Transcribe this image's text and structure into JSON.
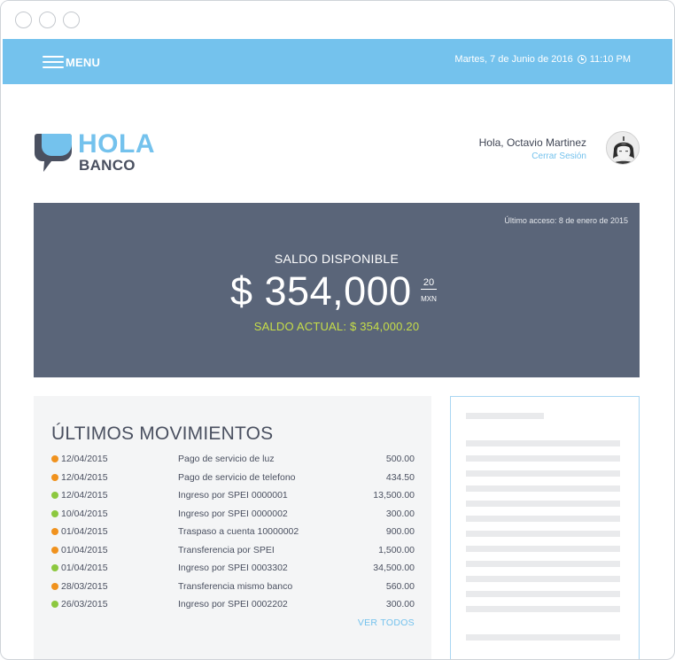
{
  "header": {
    "menu_label": "MENU",
    "date": "Martes, 7 de Junio de 2016",
    "time": "11:10 PM",
    "colors": {
      "topbar": "#74c2ed"
    }
  },
  "brand": {
    "name_top": "HOLA",
    "name_bottom": "BANCO",
    "logo_icon": "speech-bubble-icon"
  },
  "user": {
    "greeting": "Hola, Octavio Martinez",
    "logout_label": "Cerrar Sesión",
    "avatar": "avatar-photo"
  },
  "balance": {
    "last_access": "Último acceso: 8 de enero de 2015",
    "label": "SALDO DISPONIBLE",
    "amount": "$ 354,000",
    "cents": "20",
    "currency": "MXN",
    "current": "SALDO ACTUAL: $ 354,000.20",
    "colors": {
      "background": "#5a6579",
      "current": "#c7de48"
    }
  },
  "movements": {
    "title": "ÚLTIMOS MOVIMIENTOS",
    "see_all_label": "VER TODOS",
    "rows": [
      {
        "status": "orange",
        "date": "12/04/2015",
        "desc": "Pago de servicio de luz",
        "amount": "500.00"
      },
      {
        "status": "orange",
        "date": "12/04/2015",
        "desc": "Pago de servicio de telefono",
        "amount": "434.50"
      },
      {
        "status": "green",
        "date": "12/04/2015",
        "desc": "Ingreso por SPEI 0000001",
        "amount": "13,500.00"
      },
      {
        "status": "green",
        "date": "10/04/2015",
        "desc": "Ingreso por SPEI 0000002",
        "amount": "300.00"
      },
      {
        "status": "orange",
        "date": "01/04/2015",
        "desc": "Traspaso a cuenta 10000002",
        "amount": "900.00"
      },
      {
        "status": "orange",
        "date": "01/04/2015",
        "desc": "Transferencia por SPEI",
        "amount": "1,500.00"
      },
      {
        "status": "green",
        "date": "01/04/2015",
        "desc": "Ingreso por SPEI 0003302",
        "amount": "34,500.00"
      },
      {
        "status": "orange",
        "date": "28/03/2015",
        "desc": "Transferencia mismo banco",
        "amount": "560.00"
      },
      {
        "status": "green",
        "date": "26/03/2015",
        "desc": "Ingreso por SPEI 0002202",
        "amount": "300.00"
      }
    ],
    "status_colors": {
      "orange": "#f0921e",
      "green": "#8cc83f"
    }
  }
}
